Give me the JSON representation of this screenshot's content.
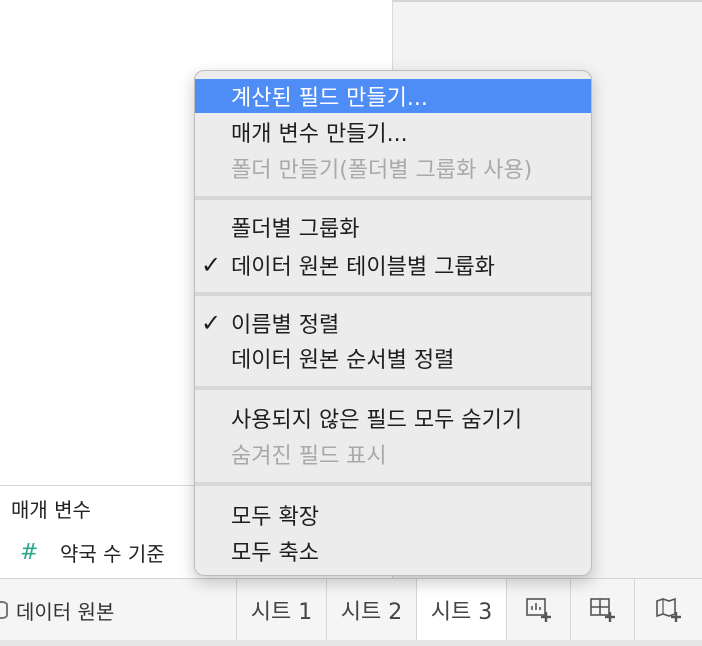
{
  "params": {
    "title": "매개 변수",
    "item_icon": "#",
    "item_label": "약국 수 기준"
  },
  "bottom_tabs": {
    "datasource_label": "데이터 원본",
    "sheets": [
      "시트 1",
      "시트 2",
      "시트 3"
    ],
    "active_sheet": "시트 3"
  },
  "context_menu": {
    "items": [
      {
        "label": "계산된 필드 만들기...",
        "state": "highlighted"
      },
      {
        "label": "매개 변수 만들기...",
        "state": "normal"
      },
      {
        "label": "폴더 만들기(폴더별 그룹화 사용)",
        "state": "disabled"
      },
      {
        "label": "폴더별 그룹화",
        "state": "normal"
      },
      {
        "label": "데이터 원본 테이블별 그룹화",
        "state": "checked"
      },
      {
        "label": "이름별 정렬",
        "state": "checked"
      },
      {
        "label": "데이터 원본 순서별 정렬",
        "state": "normal"
      },
      {
        "label": "사용되지 않은 필드 모두 숨기기",
        "state": "normal"
      },
      {
        "label": "숨겨진 필드 표시",
        "state": "disabled"
      },
      {
        "label": "모두 확장",
        "state": "normal"
      },
      {
        "label": "모두 축소",
        "state": "normal"
      }
    ],
    "check_glyph": "✓"
  },
  "colors": {
    "highlight": "#4e8df6",
    "parameter_icon": "#2aa889",
    "disabled_text": "#a9a9a9"
  }
}
